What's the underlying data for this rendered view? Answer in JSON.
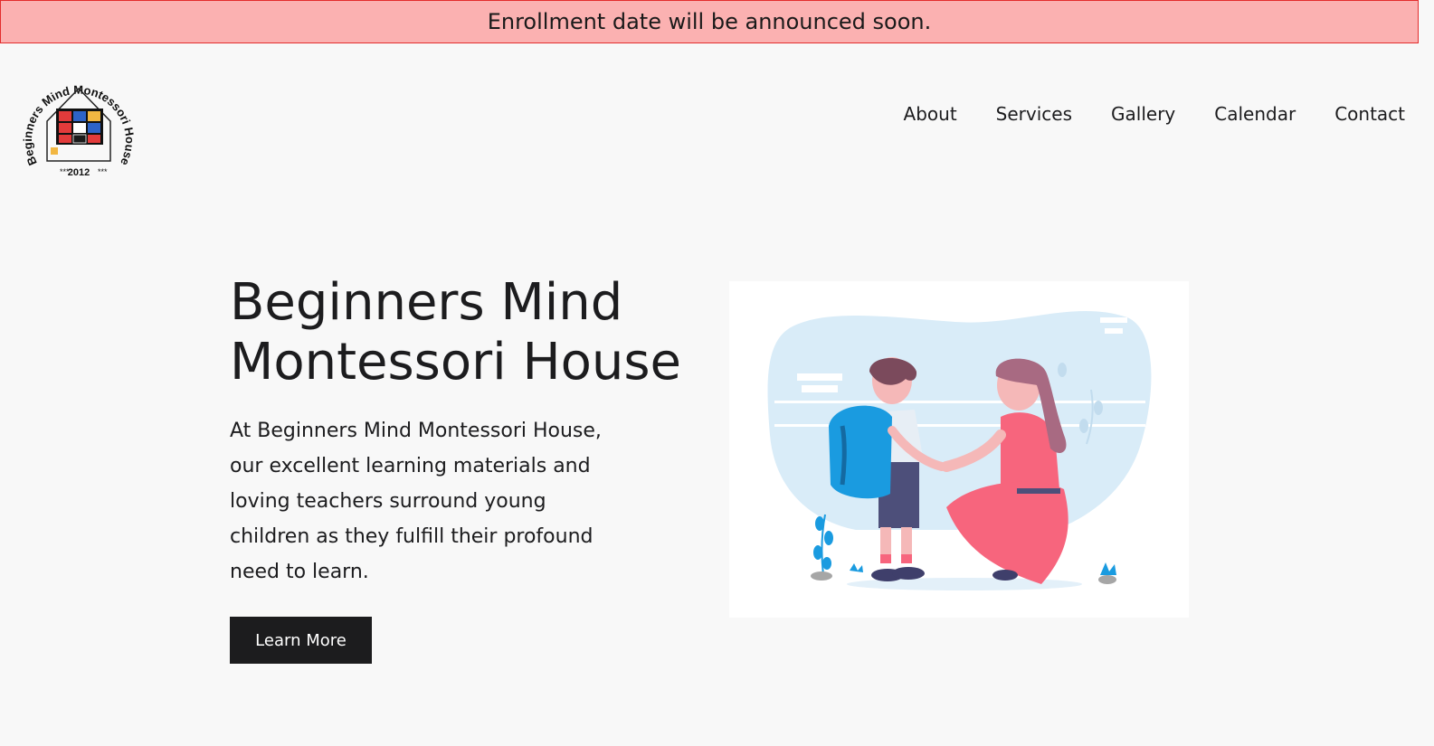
{
  "banner": {
    "text": "Enrollment date will be announced soon."
  },
  "logo": {
    "arc_text": "Beginners Mind Montessori House",
    "year": "2012",
    "stars": "***"
  },
  "nav": {
    "items": [
      {
        "label": "About"
      },
      {
        "label": "Services"
      },
      {
        "label": "Gallery"
      },
      {
        "label": "Calendar"
      },
      {
        "label": "Contact"
      }
    ]
  },
  "hero": {
    "title_line1": "Beginners Mind",
    "title_line2": "Montessori House",
    "description": "At Beginners Mind Montessori House, our excellent learning materials and loving teachers surround young children as they fulfill their profound need to learn.",
    "cta_label": "Learn More"
  },
  "colors": {
    "banner_bg": "#fbb1b1",
    "banner_border": "#e32d2d",
    "page_bg": "#f8f8f8",
    "button_bg": "#1c1c1e",
    "illustration_blue": "#d9ecf8",
    "accent_blue": "#1a9be0",
    "dress_pink": "#f7657d"
  },
  "icons": {
    "logo": "house-cube-logo",
    "illustration": "parent-child-illustration"
  }
}
